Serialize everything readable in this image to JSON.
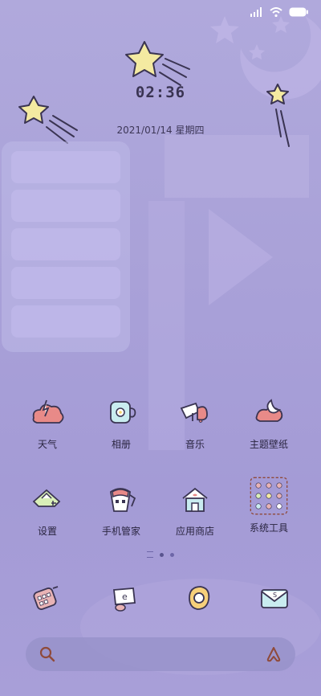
{
  "status": {
    "signal_icon": "signal-icon",
    "wifi_icon": "wifi-icon",
    "battery_icon": "battery-icon"
  },
  "lockscreen": {
    "time": "02:36",
    "date": "2021/01/14 星期四"
  },
  "apps": [
    {
      "label": "天气",
      "icon": "weather-icon"
    },
    {
      "label": "相册",
      "icon": "gallery-icon"
    },
    {
      "label": "音乐",
      "icon": "music-icon"
    },
    {
      "label": "主题壁纸",
      "icon": "theme-icon"
    },
    {
      "label": "设置",
      "icon": "settings-icon"
    },
    {
      "label": "手机管家",
      "icon": "security-icon"
    },
    {
      "label": "应用商店",
      "icon": "app-store-icon"
    },
    {
      "label": "系统工具",
      "icon": "system-tools-folder-icon"
    }
  ],
  "dock": [
    {
      "icon": "phone-icon"
    },
    {
      "icon": "browser-icon"
    },
    {
      "icon": "camera-icon"
    },
    {
      "icon": "messages-icon"
    }
  ],
  "search": {
    "search_icon": "search-icon",
    "assistant_icon": "assistant-icon"
  },
  "colors": {
    "accent": "#8f4a3a",
    "background": "#aca4da"
  }
}
